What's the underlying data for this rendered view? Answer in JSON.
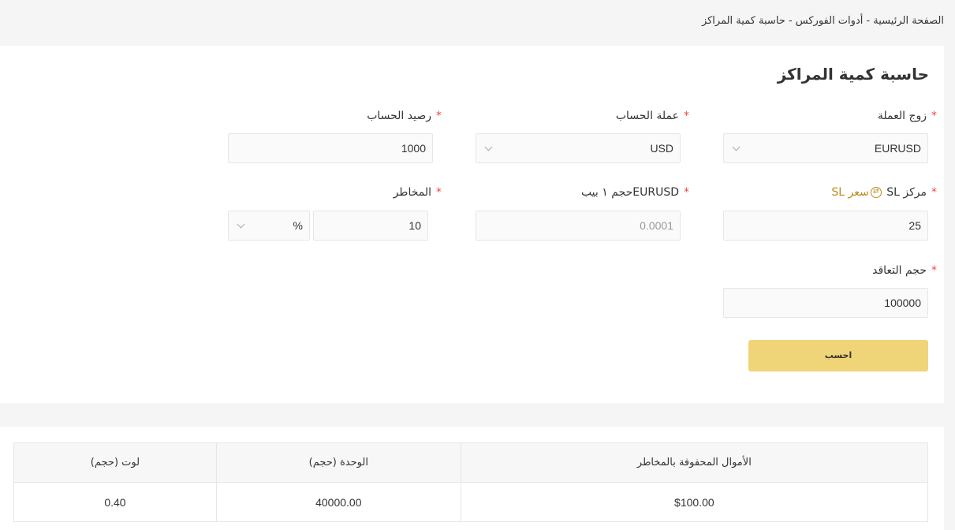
{
  "breadcrumb": {
    "text": "الصفحة الرئيسية - أدوات الفوركس - حاسبة كمية المراكز"
  },
  "title": "حاسبة كمية المراكز",
  "form": {
    "currency_pair": {
      "label": "زوج العملة",
      "value": "EURUSD"
    },
    "account_currency": {
      "label": "عملة الحساب",
      "value": "USD"
    },
    "account_balance": {
      "label": "رصيد الحساب",
      "value": "1000"
    },
    "sl_position": {
      "label": "مركز SL",
      "link_label": "سعر SL",
      "value": "25"
    },
    "pip_size": {
      "label": "EURUSDحجم ١ بيب",
      "value": "0.0001"
    },
    "risk": {
      "label": "المخاطر",
      "value": "10",
      "unit": "%"
    },
    "contract_size": {
      "label": "حجم التعاقد",
      "value": "100000"
    },
    "required_mark": "*",
    "calculate_label": "احسب"
  },
  "results": {
    "headers": [
      "الأموال المحفوفة بالمخاطر",
      "الوحدة (حجم)",
      "لوت (حجم)"
    ],
    "row": [
      "$100.00",
      "40000.00",
      "0.40"
    ]
  },
  "colors": {
    "accent": "#f0d478",
    "link": "#b88a1b",
    "required": "#e64a4a"
  }
}
